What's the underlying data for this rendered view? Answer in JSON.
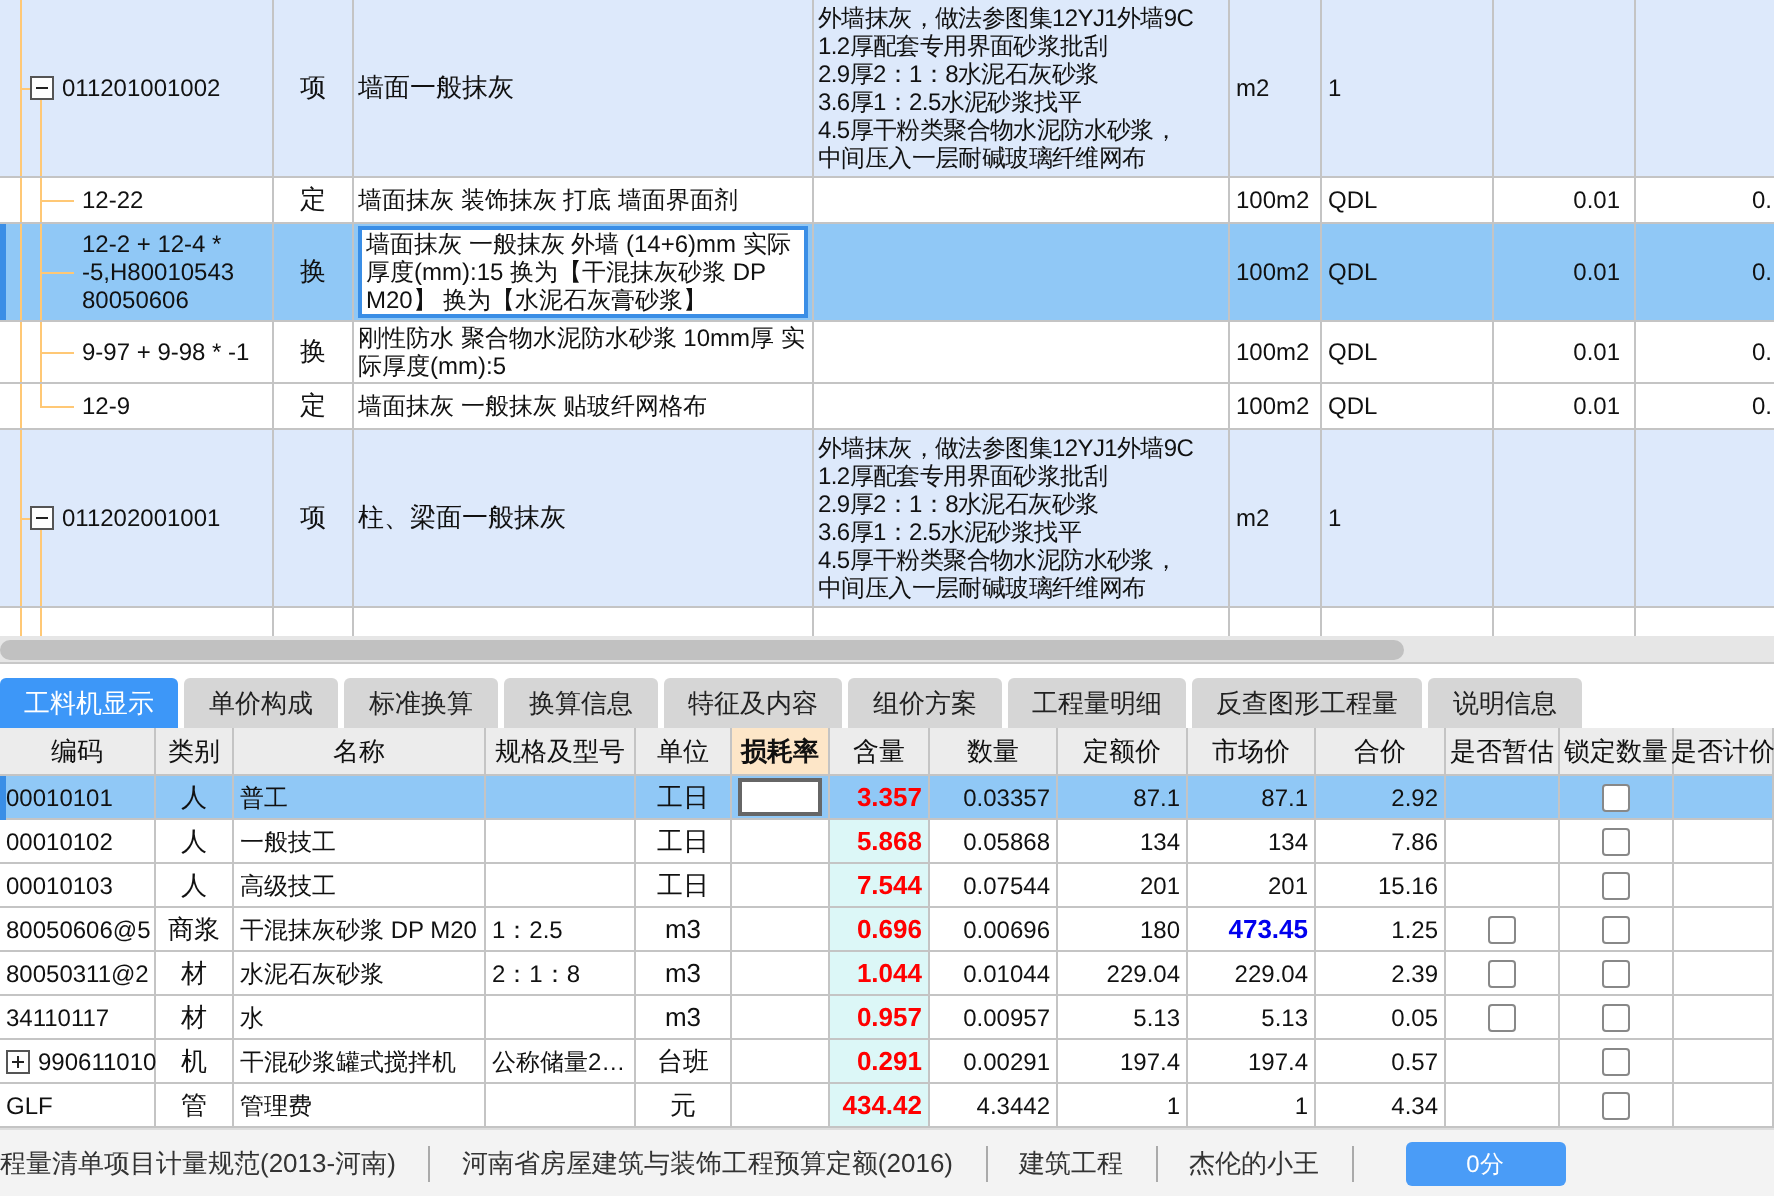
{
  "bill_items": [
    {
      "code": "011201001002",
      "type": "项",
      "name": "墙面一般抹灰",
      "feature": [
        "外墙抹灰，做法参图集12YJ1外墙9C",
        "1.2厚配套专用界面砂浆批刮",
        "2.9厚2：1：8水泥石灰砂浆",
        "3.6厚1：2.5水泥砂浆找平",
        "4.5厚干粉类聚合物水泥防水砂浆，",
        "中间压入一层耐碱玻璃纤维网布"
      ],
      "unit": "m2",
      "expression": "1",
      "selected": false,
      "expanded": true,
      "children": [
        {
          "code": "12-22",
          "type": "定",
          "name": "墙面抹灰 装饰抹灰 打底 墙面界面剂",
          "unit": "100m2",
          "expression": "QDL",
          "quantity": "0.01",
          "column_8": "0.",
          "selected": false
        },
        {
          "code": "12-2 + 12-4 * -5,H80010543 80050606",
          "type": "换",
          "name": "墙面抹灰 一般抹灰 外墙 (14+6)mm  实际厚度(mm):15  换为【干混抹灰砂浆 DP M20】 换为【水泥石灰膏砂浆】",
          "unit": "100m2",
          "expression": "QDL",
          "quantity": "0.01",
          "column_8": "0.",
          "selected": true
        },
        {
          "code": "9-97 + 9-98 * -1",
          "type": "换",
          "name": "刚性防水 聚合物水泥防水砂浆 10mm厚  实际厚度(mm):5",
          "unit": "100m2",
          "expression": "QDL",
          "quantity": "0.01",
          "column_8": "0.",
          "selected": false
        },
        {
          "code": "12-9",
          "type": "定",
          "name": "墙面抹灰 一般抹灰 贴玻纤网格布",
          "unit": "100m2",
          "expression": "QDL",
          "quantity": "0.01",
          "column_8": "0.",
          "selected": false
        }
      ]
    },
    {
      "code": "011202001001",
      "type": "项",
      "name": "柱、梁面一般抹灰",
      "feature": [
        "外墙抹灰，做法参图集12YJ1外墙9C",
        "1.2厚配套专用界面砂浆批刮",
        "2.9厚2：1：8水泥石灰砂浆",
        "3.6厚1：2.5水泥砂浆找平",
        "4.5厚干粉类聚合物水泥防水砂浆，",
        "中间压入一层耐碱玻璃纤维网布"
      ],
      "unit": "m2",
      "expression": "1",
      "selected": false,
      "expanded": true
    }
  ],
  "tabs": [
    {
      "label": "工料机显示",
      "selected": true
    },
    {
      "label": "单价构成",
      "selected": false
    },
    {
      "label": "标准换算",
      "selected": false
    },
    {
      "label": "换算信息",
      "selected": false
    },
    {
      "label": "特征及内容",
      "selected": false
    },
    {
      "label": "组价方案",
      "selected": false
    },
    {
      "label": "工程量明细",
      "selected": false
    },
    {
      "label": "反查图形工程量",
      "selected": false
    },
    {
      "label": "说明信息",
      "selected": false
    }
  ],
  "resources": {
    "columns": [
      {
        "label": "编码",
        "highlighted": false
      },
      {
        "label": "类别",
        "highlighted": false
      },
      {
        "label": "名称",
        "highlighted": false
      },
      {
        "label": "规格及型号",
        "highlighted": false
      },
      {
        "label": "单位",
        "highlighted": false
      },
      {
        "label": "损耗率",
        "highlighted": true
      },
      {
        "label": "含量",
        "highlighted": false
      },
      {
        "label": "数量",
        "highlighted": false
      },
      {
        "label": "定额价",
        "highlighted": false
      },
      {
        "label": "市场价",
        "highlighted": false
      },
      {
        "label": "合价",
        "highlighted": false
      },
      {
        "label": "是否暂估",
        "highlighted": false
      },
      {
        "label": "锁定数量",
        "highlighted": false
      },
      {
        "label": "是否计价",
        "highlighted": false
      }
    ],
    "rows": [
      {
        "code": "00010101",
        "category": "人",
        "name": "普工",
        "unit": "工日",
        "content": "3.357",
        "quantity": "0.03357",
        "quota_price": "87.1",
        "market_price": "87.1",
        "market_price_changed": false,
        "total": "2.92",
        "lock": {
          "checked": false
        },
        "selected": true
      },
      {
        "code": "00010102",
        "category": "人",
        "name": "一般技工",
        "unit": "工日",
        "content": "5.868",
        "quantity": "0.05868",
        "quota_price": "134",
        "market_price": "134",
        "market_price_changed": false,
        "total": "7.86",
        "lock": {
          "checked": false
        },
        "selected": false
      },
      {
        "code": "00010103",
        "category": "人",
        "name": "高级技工",
        "unit": "工日",
        "content": "7.544",
        "quantity": "0.07544",
        "quota_price": "201",
        "market_price": "201",
        "market_price_changed": false,
        "total": "15.16",
        "lock": {
          "checked": false
        },
        "selected": false
      },
      {
        "code": "80050606@5",
        "category": "商浆",
        "name": "干混抹灰砂浆 DP M20",
        "spec": "1：2.5",
        "unit": "m3",
        "content": "0.696",
        "quantity": "0.00696",
        "quota_price": "180",
        "market_price": "473.45",
        "market_price_changed": true,
        "total": "1.25",
        "estimate": {
          "checked": false
        },
        "lock": {
          "checked": false
        },
        "selected": false
      },
      {
        "code": "80050311@2",
        "category": "材",
        "name": "水泥石灰砂浆",
        "spec": "2：1：8",
        "unit": "m3",
        "content": "1.044",
        "quantity": "0.01044",
        "quota_price": "229.04",
        "market_price": "229.04",
        "market_price_changed": false,
        "total": "2.39",
        "estimate": {
          "checked": false
        },
        "lock": {
          "checked": false
        },
        "selected": false
      },
      {
        "code": "34110117",
        "category": "材",
        "name": "水",
        "unit": "m3",
        "content": "0.957",
        "quantity": "0.00957",
        "quota_price": "5.13",
        "market_price": "5.13",
        "market_price_changed": false,
        "total": "0.05",
        "estimate": {
          "checked": false
        },
        "lock": {
          "checked": false
        },
        "selected": false
      },
      {
        "code": "990611010",
        "category": "机",
        "name": "干混砂浆罐式搅拌机",
        "spec": "公称储量2…",
        "unit": "台班",
        "content": "0.291",
        "quantity": "0.00291",
        "quota_price": "197.4",
        "market_price": "197.4",
        "market_price_changed": false,
        "total": "0.57",
        "expander": {
          "expanded": false
        },
        "lock": {
          "checked": false
        },
        "selected": false
      },
      {
        "code": "GLF",
        "category": "管",
        "name": "管理费",
        "unit": "元",
        "content": "434.42",
        "quantity": "4.3442",
        "quota_price": "1",
        "market_price": "1",
        "market_price_changed": false,
        "total": "4.34",
        "lock": {
          "checked": false
        },
        "selected": false
      }
    ]
  },
  "status_bar": {
    "items": [
      "程量清单项目计量规范(2013-河南)",
      "河南省房屋建筑与装饰工程预算定额(2016)",
      "建筑工程",
      "杰伦的小王"
    ],
    "score_button": "0分"
  }
}
